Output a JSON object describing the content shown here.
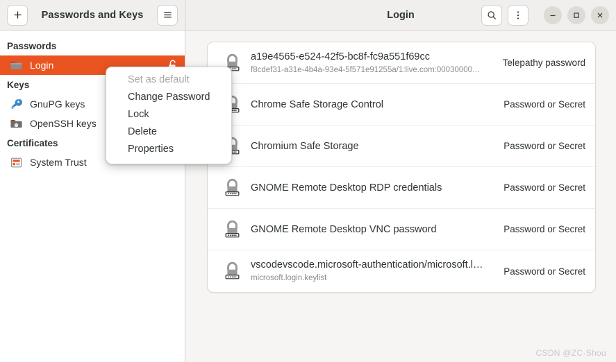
{
  "header": {
    "app_title": "Passwords and Keys",
    "window_title": "Login",
    "add_label": "+",
    "menu_icon": "hamburger-icon",
    "search_icon": "search-icon",
    "overflow_icon": "more-vertical-icon",
    "minimize_label": "–",
    "maximize_label": "☐",
    "close_label": "×"
  },
  "sidebar": {
    "groups": [
      {
        "heading": "Passwords",
        "items": [
          {
            "label": "Login",
            "icon": "keyring-folder-icon",
            "selected": true,
            "trailing_icon": "unlock-icon"
          }
        ]
      },
      {
        "heading": "Keys",
        "items": [
          {
            "label": "GnuPG keys",
            "icon": "gpg-key-icon",
            "selected": false,
            "trailing_icon": ""
          },
          {
            "label": "OpenSSH keys",
            "icon": "ssh-folder-icon",
            "selected": false,
            "trailing_icon": ""
          }
        ]
      },
      {
        "heading": "Certificates",
        "items": [
          {
            "label": "System Trust",
            "icon": "certificate-icon",
            "selected": false,
            "trailing_icon": ""
          }
        ]
      }
    ]
  },
  "context_menu": {
    "items": [
      {
        "label": "Set as default",
        "disabled": true
      },
      {
        "label": "Change Password",
        "disabled": false
      },
      {
        "label": "Lock",
        "disabled": false
      },
      {
        "label": "Delete",
        "disabled": false
      },
      {
        "label": "Properties",
        "disabled": false
      }
    ]
  },
  "list": {
    "rows": [
      {
        "title": "a19e4565-e524-42f5-bc8f-fc9a551f69cc",
        "subtitle": "f8cdef31-a31e-4b4a-93e4-5f571e91255a/1:live.com:00030000…",
        "kind": "Telepathy password",
        "icon": "lock-icon"
      },
      {
        "title": "Chrome Safe Storage Control",
        "subtitle": "",
        "kind": "Password or Secret",
        "icon": "lock-icon"
      },
      {
        "title": "Chromium Safe Storage",
        "subtitle": "",
        "kind": "Password or Secret",
        "icon": "lock-icon"
      },
      {
        "title": "GNOME Remote Desktop RDP credentials",
        "subtitle": "",
        "kind": "Password or Secret",
        "icon": "lock-icon"
      },
      {
        "title": "GNOME Remote Desktop VNC password",
        "subtitle": "",
        "kind": "Password or Secret",
        "icon": "lock-icon"
      },
      {
        "title": "vscodevscode.microsoft-authentication/microsoft.l…",
        "subtitle": "microsoft.login.keylist",
        "kind": "Password or Secret",
        "icon": "lock-icon"
      }
    ]
  },
  "watermark": "CSDN @ZC·Shou",
  "colors": {
    "accent": "#e95420",
    "headerbar": "#f0efee",
    "content_bg": "#f6f5f4",
    "text": "#2e3436",
    "muted": "#8c8c8c"
  }
}
